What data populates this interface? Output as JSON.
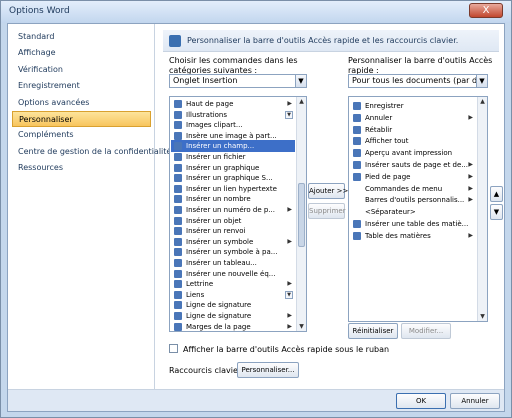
{
  "window": {
    "title": "Options Word",
    "close_label": "X"
  },
  "sidebar": {
    "items": [
      {
        "label": "Standard"
      },
      {
        "label": "Affichage"
      },
      {
        "label": "Vérification"
      },
      {
        "label": "Enregistrement"
      },
      {
        "label": "Options avancées"
      },
      {
        "label": "Personnaliser"
      },
      {
        "label": "Compléments"
      },
      {
        "label": "Centre de gestion de la confidentialité"
      },
      {
        "label": "Ressources"
      }
    ],
    "selected_index": 5
  },
  "header": {
    "text": "Personnaliser la barre d'outils Accès rapide et les raccourcis clavier."
  },
  "left": {
    "label": "Choisir les commandes dans les catégories suivantes :",
    "combo_value": "Onglet Insertion",
    "items": [
      {
        "label": "Haut de page",
        "icon": "page-header-icon",
        "suffix": "submenu"
      },
      {
        "label": "Illustrations",
        "icon": "illustrations-icon",
        "suffix": "dropdown"
      },
      {
        "label": "Images clipart...",
        "icon": "clipart-icon",
        "suffix": ""
      },
      {
        "label": "Insère une image à part...",
        "icon": "picture-icon",
        "suffix": ""
      },
      {
        "label": "Insérer un champ...",
        "icon": "field-icon",
        "suffix": ""
      },
      {
        "label": "Insérer un fichier",
        "icon": "file-icon",
        "suffix": ""
      },
      {
        "label": "Insérer un graphique",
        "icon": "chart-icon",
        "suffix": ""
      },
      {
        "label": "Insérer un graphique S...",
        "icon": "smartart-icon",
        "suffix": ""
      },
      {
        "label": "Insérer un lien hypertexte",
        "icon": "hyperlink-icon",
        "suffix": ""
      },
      {
        "label": "Insérer un nombre",
        "icon": "number-icon",
        "suffix": ""
      },
      {
        "label": "Insérer un numéro de p...",
        "icon": "page-number-icon",
        "suffix": "submenu"
      },
      {
        "label": "Insérer un objet",
        "icon": "object-icon",
        "suffix": ""
      },
      {
        "label": "Insérer un renvoi",
        "icon": "cross-reference-icon",
        "suffix": ""
      },
      {
        "label": "Insérer un symbole",
        "icon": "symbol-icon",
        "suffix": "submenu"
      },
      {
        "label": "Insérer un symbole à pa...",
        "icon": "symbol-icon",
        "suffix": ""
      },
      {
        "label": "Insérer un tableau...",
        "icon": "table-icon",
        "suffix": ""
      },
      {
        "label": "Insérer une nouvelle éq...",
        "icon": "equation-icon",
        "suffix": ""
      },
      {
        "label": "Lettrine",
        "icon": "dropcap-icon",
        "suffix": "submenu"
      },
      {
        "label": "Liens",
        "icon": "links-icon",
        "suffix": "dropdown"
      },
      {
        "label": "Ligne de signature",
        "icon": "signature-icon",
        "suffix": ""
      },
      {
        "label": "Ligne de signature",
        "icon": "signature-icon",
        "suffix": "submenu"
      },
      {
        "label": "Marges de la page",
        "icon": "margins-icon",
        "suffix": "submenu"
      }
    ],
    "selected_index": 4
  },
  "middle": {
    "add_label": "Ajouter >>",
    "remove_label": "Supprimer"
  },
  "right": {
    "label": "Personnaliser la barre d'outils Accès rapide :",
    "combo_value": "Pour tous les documents (par dé...",
    "items": [
      {
        "label": "Enregistrer",
        "icon": "save-icon",
        "suffix": ""
      },
      {
        "label": "Annuler",
        "icon": "undo-icon",
        "suffix": "submenu"
      },
      {
        "label": "Rétablir",
        "icon": "redo-icon",
        "suffix": ""
      },
      {
        "label": "Afficher tout",
        "icon": "show-all-icon",
        "suffix": ""
      },
      {
        "label": "Aperçu avant impression",
        "icon": "print-preview-icon",
        "suffix": ""
      },
      {
        "label": "Insérer sauts de page et de...",
        "icon": "page-break-icon",
        "suffix": "submenu"
      },
      {
        "label": "Pied de page",
        "icon": "page-footer-icon",
        "suffix": "submenu"
      },
      {
        "label": "Commandes de menu",
        "icon": "",
        "suffix": "submenu"
      },
      {
        "label": "Barres d'outils personnalis...",
        "icon": "",
        "suffix": "submenu"
      },
      {
        "label": "<Séparateur>",
        "icon": "",
        "suffix": ""
      },
      {
        "label": "Insérer une table des matiè...",
        "icon": "toc-icon",
        "suffix": ""
      },
      {
        "label": "Table des matières",
        "icon": "toc-icon",
        "suffix": "submenu"
      }
    ],
    "reset_label": "Réinitialiser",
    "modify_label": "Modifier...",
    "up_label": "▲",
    "down_label": "▼"
  },
  "show_below_ribbon": {
    "label": "Afficher la barre d'outils Accès rapide sous le ruban",
    "checked": false
  },
  "shortcuts": {
    "label": "Raccourcis clavier :",
    "button_label": "Personnaliser..."
  },
  "footer": {
    "ok_label": "OK",
    "cancel_label": "Annuler"
  }
}
